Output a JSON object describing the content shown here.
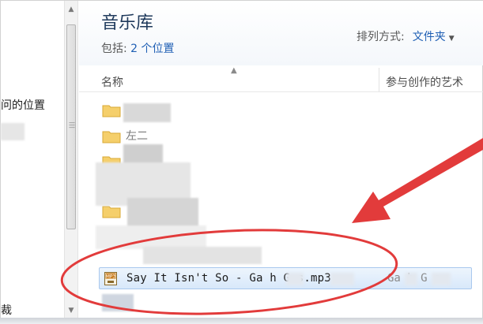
{
  "nav": {
    "item_location": "问的位置",
    "item_bottom": "裁"
  },
  "library": {
    "title": "音乐库",
    "includes_label": "包括:",
    "includes_link": "2 个位置",
    "arrange_label": "排列方式:",
    "arrange_value": "文件夹"
  },
  "columns": {
    "name": "名称",
    "artist": "参与创作的艺术"
  },
  "selected_file": {
    "name": "Say It Isn't So - Ga  h G   s.mp3",
    "artist": "Ga  h G  s",
    "icon": "mp3-file-icon"
  },
  "partial_folder_label": "左二",
  "annotation_color": "#e23b3b",
  "accent_color": "#1f5fb4"
}
